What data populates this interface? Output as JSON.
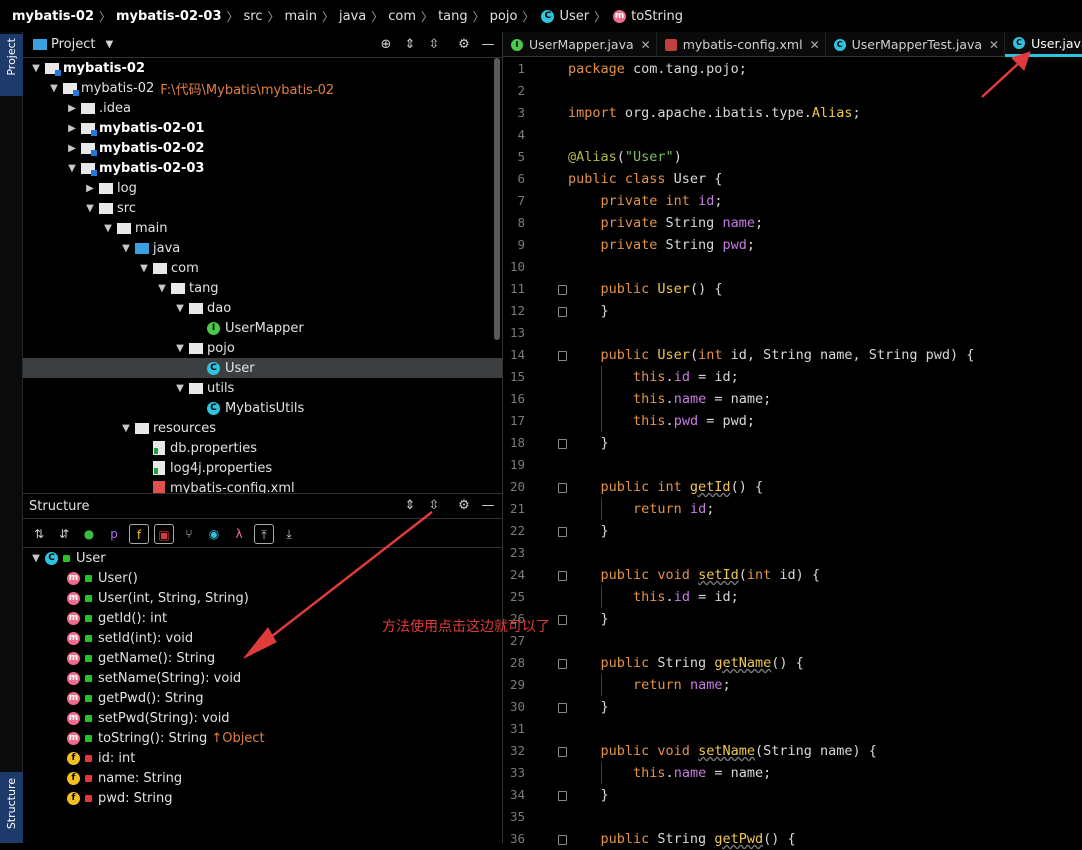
{
  "breadcrumb": [
    {
      "label": "mybatis-02",
      "bold": true
    },
    {
      "label": "mybatis-02-03",
      "bold": true
    },
    {
      "label": "src"
    },
    {
      "label": "main"
    },
    {
      "label": "java"
    },
    {
      "label": "com"
    },
    {
      "label": "tang"
    },
    {
      "label": "pojo"
    },
    {
      "label": "User",
      "icon": "class-icon"
    },
    {
      "label": "toString",
      "icon": "method-icon"
    }
  ],
  "side_tabs": {
    "project": "Project",
    "structure": "Structure"
  },
  "project_panel": {
    "title": "Project",
    "tree": [
      {
        "label": "mybatis-02",
        "depth": 0,
        "arrow": "down",
        "icon": "module-folder",
        "bold": true
      },
      {
        "label": "mybatis-02",
        "path": "F:\\代码\\Mybatis\\mybatis-02",
        "depth": 1,
        "arrow": "down",
        "icon": "module-folder"
      },
      {
        "label": ".idea",
        "depth": 2,
        "arrow": "right",
        "icon": "folder"
      },
      {
        "label": "mybatis-02-01",
        "depth": 2,
        "arrow": "right",
        "icon": "module-folder",
        "bold": true
      },
      {
        "label": "mybatis-02-02",
        "depth": 2,
        "arrow": "right",
        "icon": "module-folder",
        "bold": true
      },
      {
        "label": "mybatis-02-03",
        "depth": 2,
        "arrow": "down",
        "icon": "module-folder",
        "bold": true
      },
      {
        "label": "log",
        "depth": 3,
        "arrow": "right",
        "icon": "folder"
      },
      {
        "label": "src",
        "depth": 3,
        "arrow": "down",
        "icon": "folder"
      },
      {
        "label": "main",
        "depth": 4,
        "arrow": "down",
        "icon": "folder"
      },
      {
        "label": "java",
        "depth": 5,
        "arrow": "down",
        "icon": "source-folder"
      },
      {
        "label": "com",
        "depth": 6,
        "arrow": "down",
        "icon": "package"
      },
      {
        "label": "tang",
        "depth": 7,
        "arrow": "down",
        "icon": "package"
      },
      {
        "label": "dao",
        "depth": 8,
        "arrow": "down",
        "icon": "package"
      },
      {
        "label": "UserMapper",
        "depth": 9,
        "arrow": "",
        "icon": "interface"
      },
      {
        "label": "pojo",
        "depth": 8,
        "arrow": "down",
        "icon": "package"
      },
      {
        "label": "User",
        "depth": 9,
        "arrow": "",
        "icon": "class",
        "selected": true
      },
      {
        "label": "utils",
        "depth": 8,
        "arrow": "down",
        "icon": "package"
      },
      {
        "label": "MybatisUtils",
        "depth": 9,
        "arrow": "",
        "icon": "class"
      },
      {
        "label": "resources",
        "depth": 5,
        "arrow": "down",
        "icon": "resource-folder"
      },
      {
        "label": "db.properties",
        "depth": 6,
        "arrow": "",
        "icon": "properties-file"
      },
      {
        "label": "log4j.properties",
        "depth": 6,
        "arrow": "",
        "icon": "properties-file"
      },
      {
        "label": "mybatis-config.xml",
        "depth": 6,
        "arrow": "",
        "icon": "xml-file"
      }
    ]
  },
  "structure_panel": {
    "title": "Structure",
    "toolbar_icons": [
      "sort-by-visibility-icon",
      "sort-alpha-icon",
      "show-inherited-icon",
      "show-properties-icon",
      "show-fields-icon",
      "show-non-public-icon",
      "show-anonymous-icon",
      "show-lambdas-icon",
      "lambda-icon",
      "autoscroll-to-source-icon",
      "autoscroll-from-source-icon"
    ],
    "root": "User",
    "members": [
      {
        "kind": "method",
        "lock": "green",
        "label": "User()"
      },
      {
        "kind": "method",
        "lock": "green",
        "label": "User(int, String, String)"
      },
      {
        "kind": "method",
        "lock": "green",
        "label": "getId(): int"
      },
      {
        "kind": "method",
        "lock": "green",
        "label": "setId(int): void"
      },
      {
        "kind": "method",
        "lock": "green",
        "label": "getName(): String"
      },
      {
        "kind": "method",
        "lock": "green",
        "label": "setName(String): void"
      },
      {
        "kind": "method",
        "lock": "green",
        "label": "getPwd(): String"
      },
      {
        "kind": "method",
        "lock": "green",
        "label": "setPwd(String): void"
      },
      {
        "kind": "method",
        "lock": "green",
        "label": "toString(): String",
        "inherited": "↑Object"
      },
      {
        "kind": "field",
        "lock": "red",
        "label": "id: int"
      },
      {
        "kind": "field",
        "lock": "red",
        "label": "name: String"
      },
      {
        "kind": "field",
        "lock": "red",
        "label": "pwd: String"
      }
    ]
  },
  "editor": {
    "tabs": [
      {
        "label": "UserMapper.java",
        "icon": "interface-icon",
        "active": false
      },
      {
        "label": "mybatis-config.xml",
        "icon": "xml-icon",
        "active": false
      },
      {
        "label": "UserMapperTest.java",
        "icon": "class-icon",
        "active": false
      },
      {
        "label": "User.java",
        "icon": "class-icon",
        "active": true
      }
    ],
    "lines": [
      [
        [
          "kw",
          "package "
        ],
        [
          "pl",
          "com.tang.pojo;"
        ]
      ],
      [],
      [
        [
          "kw",
          "import "
        ],
        [
          "pl",
          "org.apache.ibatis.type."
        ],
        [
          "al",
          "Alias"
        ],
        [
          "pl",
          ";"
        ]
      ],
      [],
      [
        [
          "ann",
          "@Alias"
        ],
        [
          "pl",
          "("
        ],
        [
          "str",
          "\"User\""
        ],
        [
          "pl",
          ")"
        ]
      ],
      [
        [
          "kw",
          "public class "
        ],
        [
          "pl",
          "User {"
        ]
      ],
      [
        [
          "pl",
          "    "
        ],
        [
          "kw",
          "private int "
        ],
        [
          "fld",
          "id"
        ],
        [
          "pl",
          ";"
        ]
      ],
      [
        [
          "pl",
          "    "
        ],
        [
          "kw",
          "private "
        ],
        [
          "pl",
          "String "
        ],
        [
          "fld",
          "name"
        ],
        [
          "pl",
          ";"
        ]
      ],
      [
        [
          "pl",
          "    "
        ],
        [
          "kw",
          "private "
        ],
        [
          "pl",
          "String "
        ],
        [
          "fld",
          "pwd"
        ],
        [
          "pl",
          ";"
        ]
      ],
      [],
      [
        [
          "pl",
          "    "
        ],
        [
          "kw",
          "public "
        ],
        [
          "meth",
          "User"
        ],
        [
          "pl",
          "() {"
        ]
      ],
      [
        [
          "pl",
          "    }"
        ]
      ],
      [],
      [
        [
          "pl",
          "    "
        ],
        [
          "kw",
          "public "
        ],
        [
          "meth",
          "User"
        ],
        [
          "pl",
          "("
        ],
        [
          "kw",
          "int "
        ],
        [
          "pl",
          "id, String name, String pwd) {"
        ]
      ],
      [
        [
          "pl",
          "        "
        ],
        [
          "kw",
          "this"
        ],
        [
          "pl",
          "."
        ],
        [
          "fld",
          "id"
        ],
        [
          "pl",
          " = id;"
        ]
      ],
      [
        [
          "pl",
          "        "
        ],
        [
          "kw",
          "this"
        ],
        [
          "pl",
          "."
        ],
        [
          "fld",
          "name"
        ],
        [
          "pl",
          " = name;"
        ]
      ],
      [
        [
          "pl",
          "        "
        ],
        [
          "kw",
          "this"
        ],
        [
          "pl",
          "."
        ],
        [
          "fld",
          "pwd"
        ],
        [
          "pl",
          " = pwd;"
        ]
      ],
      [
        [
          "pl",
          "    }"
        ]
      ],
      [],
      [
        [
          "pl",
          "    "
        ],
        [
          "kw",
          "public int "
        ],
        [
          "meth",
          "getId"
        ],
        [
          "pl",
          "() {"
        ]
      ],
      [
        [
          "pl",
          "        "
        ],
        [
          "kw",
          "return "
        ],
        [
          "fld",
          "id"
        ],
        [
          "pl",
          ";"
        ]
      ],
      [
        [
          "pl",
          "    }"
        ]
      ],
      [],
      [
        [
          "pl",
          "    "
        ],
        [
          "kw",
          "public void "
        ],
        [
          "meth",
          "setId"
        ],
        [
          "pl",
          "("
        ],
        [
          "kw",
          "int "
        ],
        [
          "pl",
          "id) {"
        ]
      ],
      [
        [
          "pl",
          "        "
        ],
        [
          "kw",
          "this"
        ],
        [
          "pl",
          "."
        ],
        [
          "fld",
          "id"
        ],
        [
          "pl",
          " = id;"
        ]
      ],
      [
        [
          "pl",
          "    }"
        ]
      ],
      [],
      [
        [
          "pl",
          "    "
        ],
        [
          "kw",
          "public "
        ],
        [
          "pl",
          "String "
        ],
        [
          "meth",
          "getName"
        ],
        [
          "pl",
          "() {"
        ]
      ],
      [
        [
          "pl",
          "        "
        ],
        [
          "kw",
          "return "
        ],
        [
          "fld",
          "name"
        ],
        [
          "pl",
          ";"
        ]
      ],
      [
        [
          "pl",
          "    }"
        ]
      ],
      [],
      [
        [
          "pl",
          "    "
        ],
        [
          "kw",
          "public void "
        ],
        [
          "meth",
          "setName"
        ],
        [
          "pl",
          "(String name) {"
        ]
      ],
      [
        [
          "pl",
          "        "
        ],
        [
          "kw",
          "this"
        ],
        [
          "pl",
          "."
        ],
        [
          "fld",
          "name"
        ],
        [
          "pl",
          " = name;"
        ]
      ],
      [
        [
          "pl",
          "    }"
        ]
      ],
      [],
      [
        [
          "pl",
          "    "
        ],
        [
          "kw",
          "public "
        ],
        [
          "pl",
          "String "
        ],
        [
          "meth",
          "getPwd"
        ],
        [
          "pl",
          "() {"
        ]
      ]
    ],
    "line_numbers": [
      "1",
      "2",
      "3",
      "4",
      "5",
      "6",
      "7",
      "8",
      "9",
      "10",
      "11",
      "12",
      "13",
      "14",
      "15",
      "16",
      "17",
      "18",
      "19",
      "20",
      "21",
      "22",
      "23",
      "24",
      "25",
      "26",
      "27",
      "28",
      "29",
      "30",
      "31",
      "32",
      "33",
      "34",
      "35",
      "36"
    ]
  },
  "annotation": {
    "text": "方法使用点击这边就可以了",
    "color": "#e03b3b"
  }
}
